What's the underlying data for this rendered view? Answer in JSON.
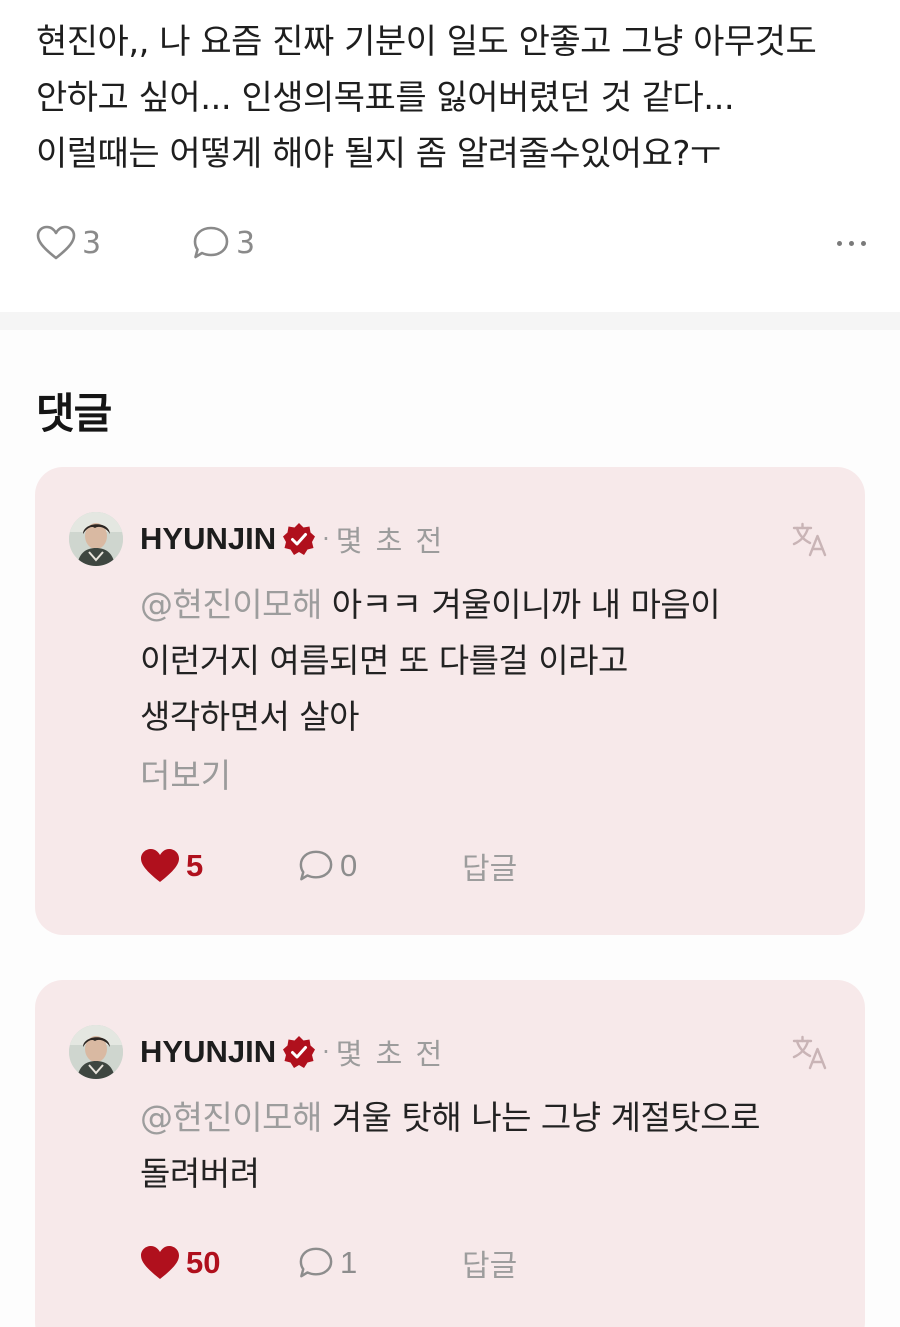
{
  "post": {
    "lines": [
      "현진아,, 나 요즘 진짜 기분이 일도 안좋고 그냥 아무것도",
      "안하고 싶어... 인생의목표를 잃어버렸던 것 같다...",
      "이럴때는 어떻게 해야 될지 좀 알려줄수있어요?ㅜ"
    ],
    "like_count": "3",
    "comment_count": "3",
    "icons": [
      "heart-outline-icon",
      "speech-bubble-icon",
      "more-dots-icon"
    ]
  },
  "comments_title": "댓글",
  "comments": [
    {
      "author": "HYUNJIN",
      "dot": "·",
      "time": "몇 초 전",
      "mention": "@현진이모해",
      "lines": [
        " 아ㅋㅋ 겨울이니까 내 마음이",
        "이런거지 여름되면 또 다를걸 이라고",
        "생각하면서 살아"
      ],
      "see_more": "더보기",
      "like_count": "5",
      "reply_count": "0",
      "reply_label": "답글"
    },
    {
      "author": "HYUNJIN",
      "dot": "·",
      "time": "몇 초 전",
      "mention": "@현진이모해",
      "lines": [
        " 겨울 탓해 나는 그냥 계절탓으로",
        "돌려버려"
      ],
      "like_count": "50",
      "reply_count": "1",
      "reply_label": "답글"
    }
  ],
  "colors": {
    "card_bg": "#f7e9ea",
    "accent_red": "#b0101d",
    "muted_text": "#9d9d9d",
    "divider": "#f5f5f5"
  }
}
